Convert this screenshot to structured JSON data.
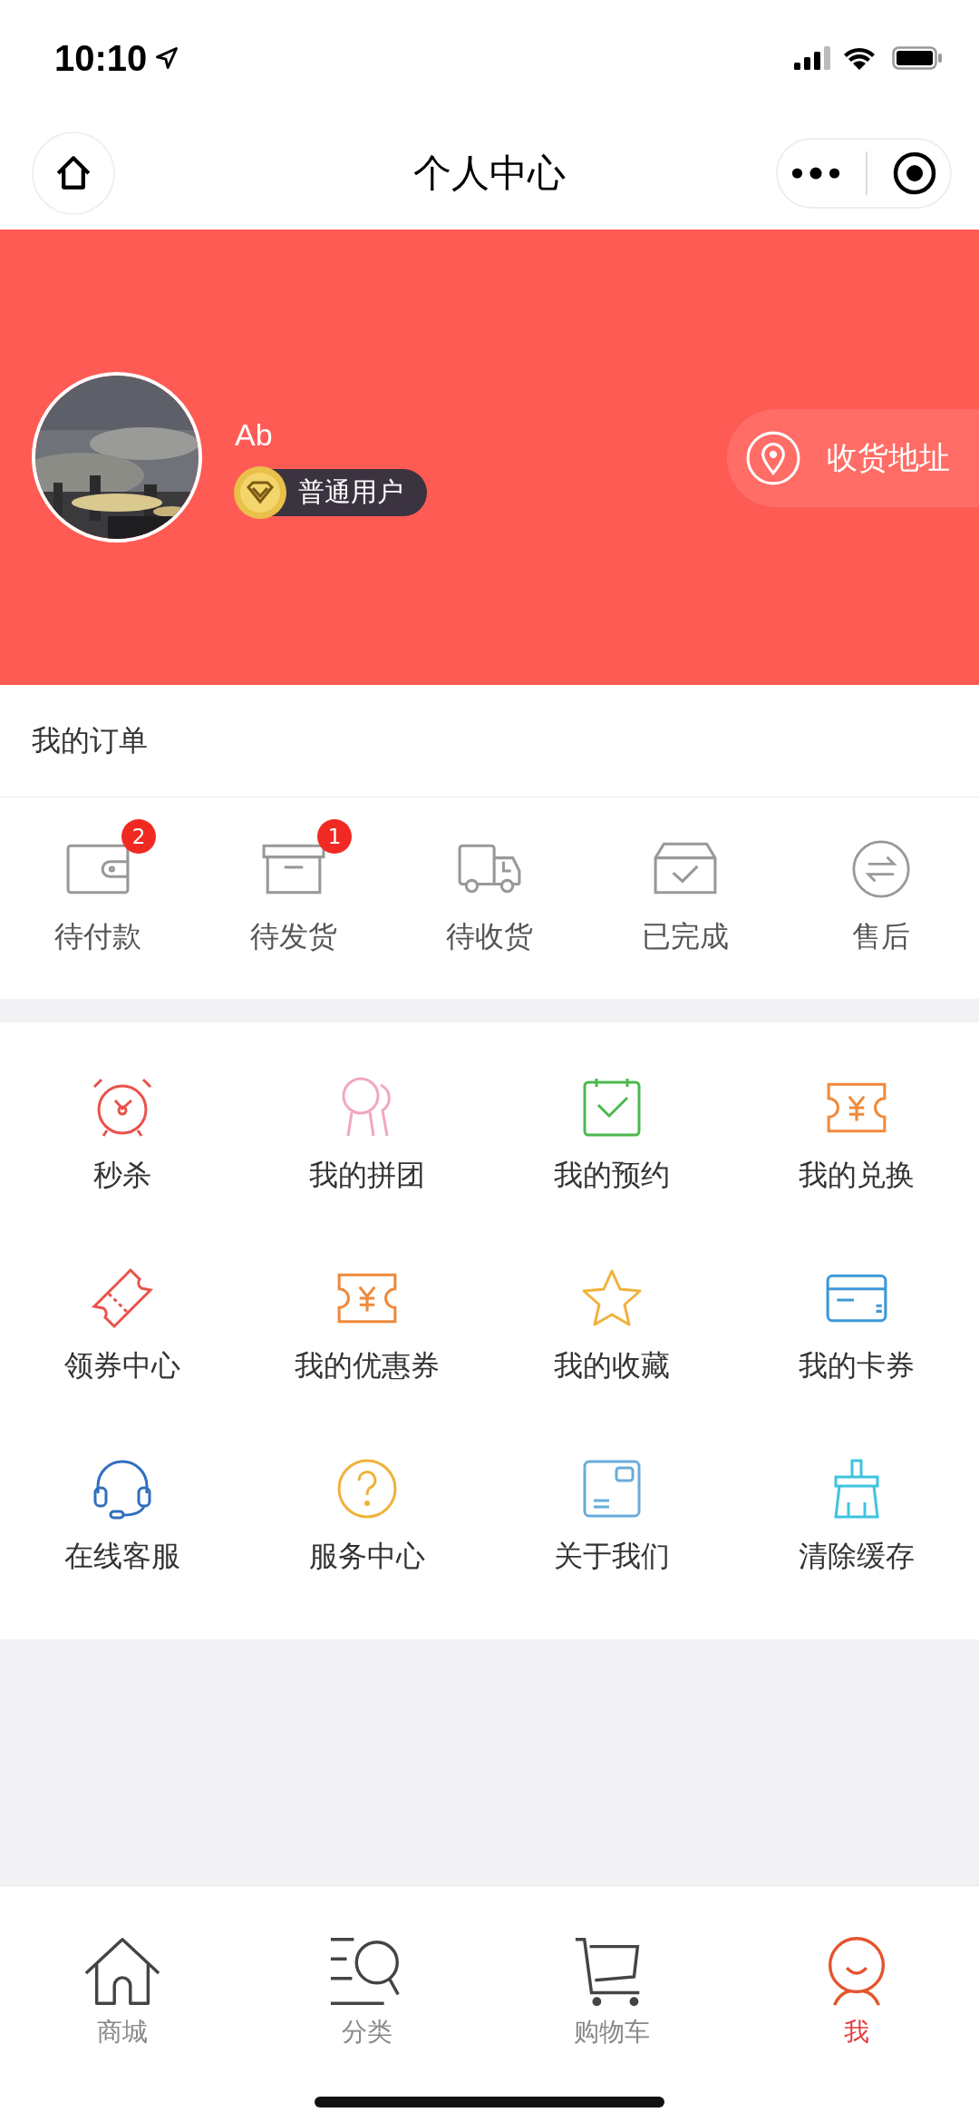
{
  "status_bar": {
    "time": "10:10"
  },
  "nav": {
    "title": "个人中心"
  },
  "profile": {
    "name": "Ab",
    "level": "普通用户",
    "address_button": "收货地址"
  },
  "orders": {
    "title": "我的订单",
    "items": [
      {
        "kind": "wallet",
        "label": "待付款",
        "badge": "2"
      },
      {
        "kind": "box",
        "label": "待发货",
        "badge": "1"
      },
      {
        "kind": "truck",
        "label": "待收货"
      },
      {
        "kind": "done",
        "label": "已完成"
      },
      {
        "kind": "return",
        "label": "售后"
      }
    ]
  },
  "services": [
    {
      "kind": "alarm",
      "label": "秒杀"
    },
    {
      "kind": "group",
      "label": "我的拼团"
    },
    {
      "kind": "calendar",
      "label": "我的预约"
    },
    {
      "kind": "exchange",
      "label": "我的兑换"
    },
    {
      "kind": "ticket",
      "label": "领券中心"
    },
    {
      "kind": "coupon",
      "label": "我的优惠券"
    },
    {
      "kind": "star",
      "label": "我的收藏"
    },
    {
      "kind": "card",
      "label": "我的卡券"
    },
    {
      "kind": "headset",
      "label": "在线客服"
    },
    {
      "kind": "help",
      "label": "服务中心"
    },
    {
      "kind": "about",
      "label": "关于我们"
    },
    {
      "kind": "broom",
      "label": "清除缓存"
    }
  ],
  "tab_bar": [
    {
      "kind": "home",
      "label": "商城",
      "selected": false
    },
    {
      "kind": "category",
      "label": "分类",
      "selected": false
    },
    {
      "kind": "cart",
      "label": "购物车",
      "selected": false
    },
    {
      "kind": "me",
      "label": "我",
      "selected": true
    }
  ]
}
